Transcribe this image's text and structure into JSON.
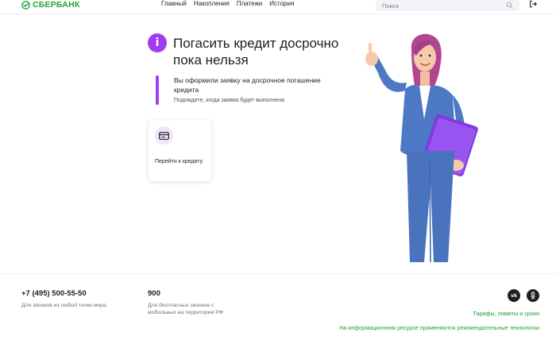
{
  "header": {
    "logo_text": "СБЕРБАНК",
    "nav": [
      "Главный",
      "Накопления",
      "Платежи",
      "История"
    ],
    "search_placeholder": "Поиск"
  },
  "main": {
    "title": "Погасить кредит досрочно пока нельзя",
    "info_icon_glyph": "i",
    "notice_title": "Вы оформили заявку на досрочное погашение кредита",
    "notice_subtitle": "Подождите, когда заявка будет выполнена",
    "card_label": "Перейти к кредиту"
  },
  "footer": {
    "phone": "+7 (495) 500-55-50",
    "phone_desc": "Для звонков из любой точки мира",
    "short_number": "900",
    "short_desc": "Для бесплатных звонков с мобильных на территории РФ",
    "vk_label": "vk",
    "ok_label": "ok",
    "tariffs_link": "Тарифы, лимиты и сроки",
    "tech_link": "На информационном ресурсе применяются рекомендательные технологии"
  },
  "colors": {
    "brand_green": "#21a038",
    "accent_purple": "#a23cf0"
  },
  "icons": [
    "sber-logo-icon",
    "search-icon",
    "logout-icon",
    "info-icon",
    "card-icon",
    "vk-icon",
    "ok-icon"
  ]
}
